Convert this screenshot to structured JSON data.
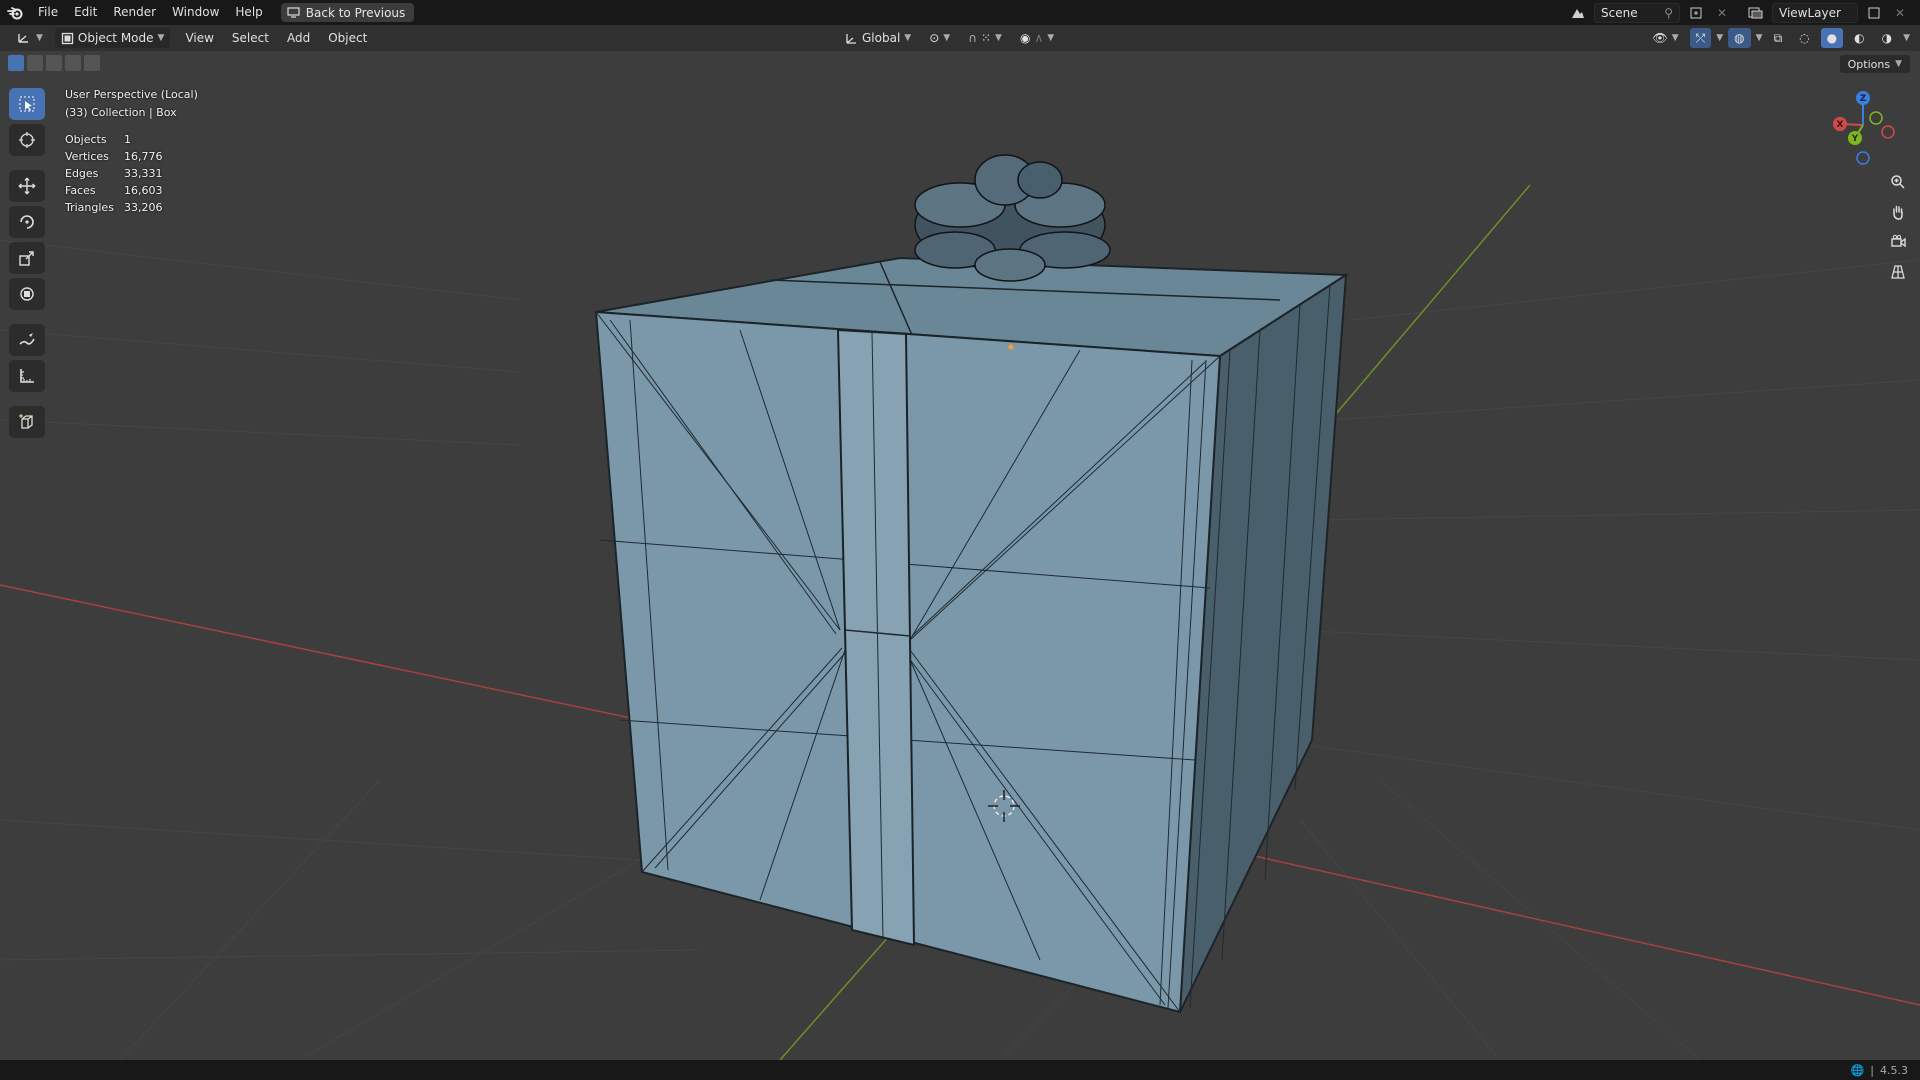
{
  "topbar": {
    "menus": [
      "File",
      "Edit",
      "Render",
      "Window",
      "Help"
    ],
    "back_button": "Back to Previous",
    "scene": "Scene",
    "view_layer": "ViewLayer"
  },
  "header": {
    "mode": "Object Mode",
    "menus": [
      "View",
      "Select",
      "Add",
      "Object"
    ],
    "transform_orientation": "Global"
  },
  "options_label": "Options",
  "overlay": {
    "perspective": "User Perspective (Local)",
    "collection": "(33) Collection | Box",
    "stats": [
      {
        "label": "Objects",
        "value": "1"
      },
      {
        "label": "Vertices",
        "value": "16,776"
      },
      {
        "label": "Edges",
        "value": "33,331"
      },
      {
        "label": "Faces",
        "value": "16,603"
      },
      {
        "label": "Triangles",
        "value": "33,206"
      }
    ]
  },
  "gizmo": {
    "x": "X",
    "y": "Y",
    "z": "Z"
  },
  "statusbar": {
    "version": "4.5.3"
  },
  "colors": {
    "accent": "#4772b3",
    "box_front": "#7b98aa",
    "box_side": "#4d6270",
    "axis_x": "#d04a4a",
    "axis_y": "#7fb51f",
    "axis_z": "#3c7de0"
  }
}
